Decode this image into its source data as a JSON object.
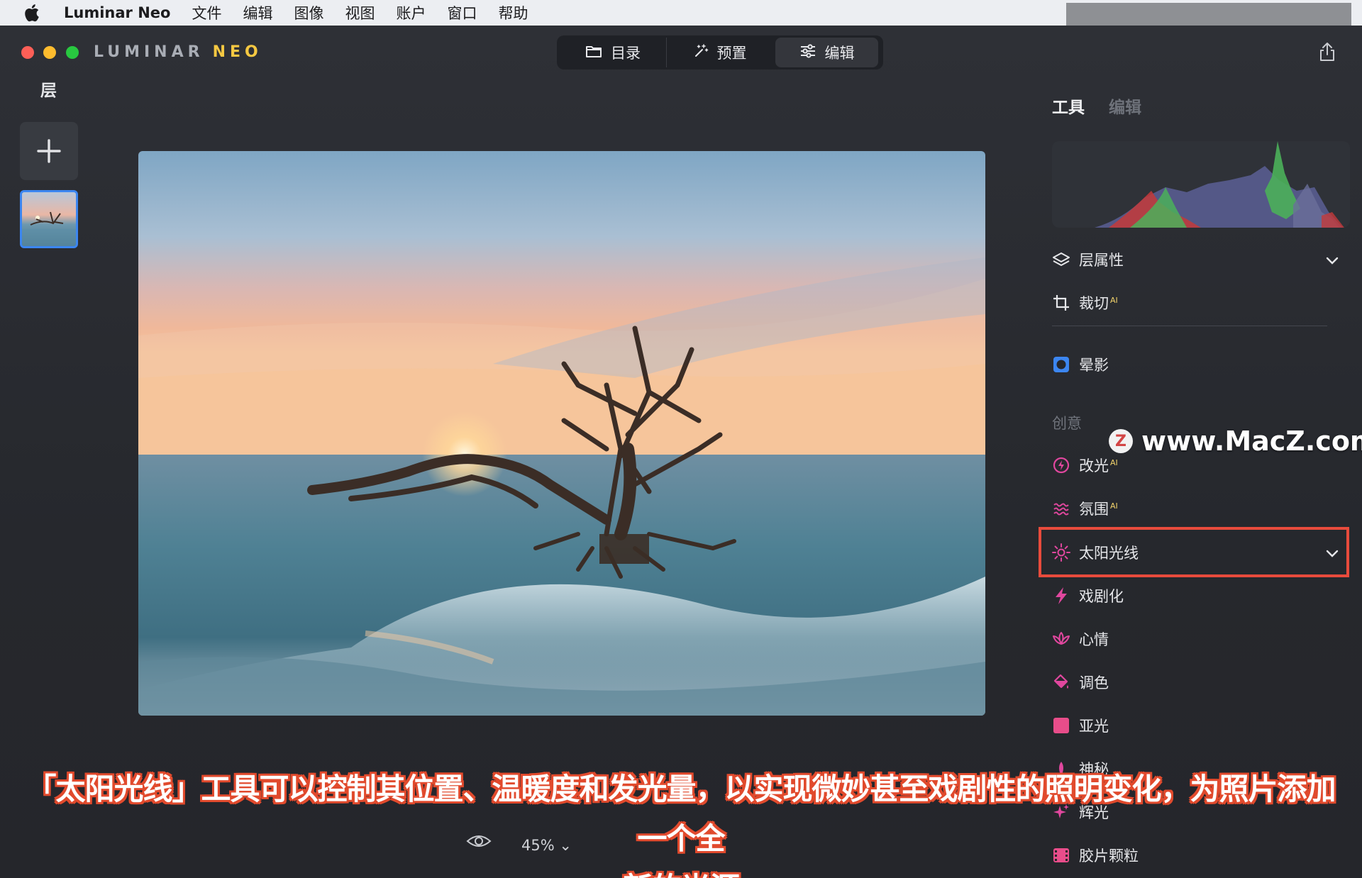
{
  "menubar": {
    "app_name": "Luminar Neo",
    "items": [
      "文件",
      "编辑",
      "图像",
      "视图",
      "账户",
      "窗口",
      "帮助"
    ]
  },
  "window": {
    "brand_luminar": "LUMINAR",
    "brand_neo": "NEO",
    "nav": [
      {
        "label": "目录",
        "icon": "folder-icon"
      },
      {
        "label": "预置",
        "icon": "magic-wand-icon"
      },
      {
        "label": "编辑",
        "icon": "sliders-icon",
        "active": true
      }
    ]
  },
  "left_panel": {
    "title": "层"
  },
  "bottom_bar": {
    "zoom": "45% ⌄"
  },
  "right_panel": {
    "tabs": {
      "tools": "工具",
      "edits": "编辑"
    },
    "tools_top": [
      {
        "label": "层属性",
        "icon": "layers-icon",
        "ai": ""
      },
      {
        "label": "裁切",
        "icon": "crop-icon",
        "ai": "AI"
      },
      {
        "label": "晕影",
        "icon": "vignette-icon",
        "ai": ""
      }
    ],
    "section_creative": "创意",
    "tools_creative": [
      {
        "label": "改光",
        "icon": "relight-icon",
        "ai": "AI"
      },
      {
        "label": "氛围",
        "icon": "atmosphere-icon",
        "ai": "AI"
      },
      {
        "label": "太阳光线",
        "icon": "sun-rays-icon",
        "ai": ""
      },
      {
        "label": "戏剧化",
        "icon": "lightning-icon",
        "ai": ""
      },
      {
        "label": "心情",
        "icon": "lotus-icon",
        "ai": ""
      },
      {
        "label": "调色",
        "icon": "paint-bucket-icon",
        "ai": ""
      },
      {
        "label": "亚光",
        "icon": "matte-icon",
        "ai": ""
      },
      {
        "label": "神秘",
        "icon": "mystic-icon",
        "ai": ""
      },
      {
        "label": "辉光",
        "icon": "glow-icon",
        "ai": ""
      },
      {
        "label": "胶片颗粒",
        "icon": "film-grain-icon",
        "ai": ""
      }
    ]
  },
  "watermark": {
    "logo": "Z",
    "text": "www.MacZ.com"
  },
  "caption": {
    "line1": "「太阳光线」工具可以控制其位置、温暖度和发光量，以实现微妙甚至戏剧性的照明变化，为照片添加一个全",
    "line2": "新的光源"
  },
  "colors": {
    "highlight_border": "#e84b3c",
    "caption_stroke": "#e14a2d",
    "accent_blue": "#3c86f0",
    "ai_badge": "#f3d46b"
  }
}
